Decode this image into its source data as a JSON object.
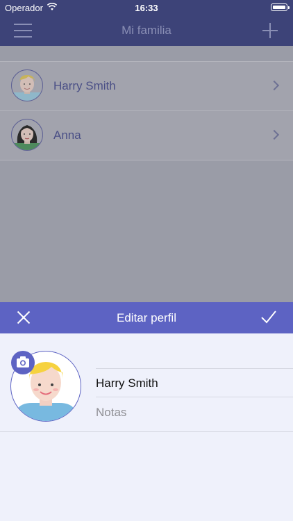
{
  "status_bar": {
    "carrier": "Operador",
    "time": "16:33",
    "icons": [
      "wifi-icon",
      "battery-icon"
    ]
  },
  "navbar": {
    "title": "Mi familia",
    "icons": [
      "hamburger-menu-icon",
      "plus-icon"
    ]
  },
  "family_list": [
    {
      "name": "Harry Smith",
      "avatar": "boy-avatar-icon"
    },
    {
      "name": "Anna",
      "avatar": "girl-avatar-icon"
    }
  ],
  "edit_sheet": {
    "title": "Editar perfil",
    "icons": [
      "close-icon",
      "checkmark-icon",
      "camera-icon"
    ],
    "name_value": "Harry Smith",
    "notes_placeholder": "Notas"
  },
  "colors": {
    "nav_bg": "#3d4378",
    "sheet_header": "#5d63c3",
    "sheet_body": "#eff1fb",
    "overlay": "#9a9ca7",
    "name_text": "#4a4f86"
  }
}
